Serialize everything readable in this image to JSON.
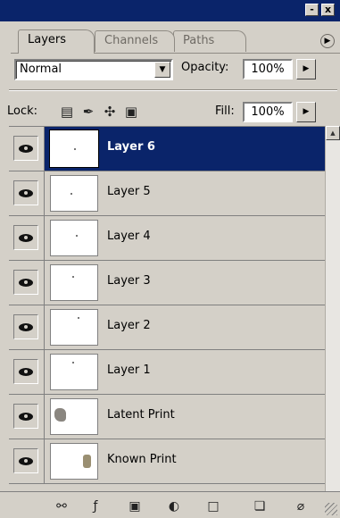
{
  "window": {
    "minimize_label": "-",
    "close_label": "x",
    "titlebar_color": "#0a246a"
  },
  "tabs": [
    {
      "label": "Layers",
      "active": true
    },
    {
      "label": "Channels",
      "active": false
    },
    {
      "label": "Paths",
      "active": false
    }
  ],
  "panel_menu_icon": "panel-menu-arrow-icon",
  "blend": {
    "mode": "Normal",
    "opacity_label": "Opacity:",
    "opacity_value": "100%"
  },
  "lock": {
    "label": "Lock:",
    "icons": [
      "lock-transparent-pixels-icon",
      "lock-image-pixels-icon",
      "lock-position-icon",
      "lock-all-icon"
    ],
    "fill_label": "Fill:",
    "fill_value": "100%"
  },
  "layers": [
    {
      "name": "Layer 6",
      "selected": true,
      "visible": true
    },
    {
      "name": "Layer 5",
      "selected": false,
      "visible": true
    },
    {
      "name": "Layer 4",
      "selected": false,
      "visible": true
    },
    {
      "name": "Layer 3",
      "selected": false,
      "visible": true
    },
    {
      "name": "Layer 2",
      "selected": false,
      "visible": true
    },
    {
      "name": "Layer 1",
      "selected": false,
      "visible": true
    },
    {
      "name": "Latent Print",
      "selected": false,
      "visible": true
    },
    {
      "name": "Known Print",
      "selected": false,
      "visible": true
    }
  ],
  "bottom_icons": [
    "link-layers-icon",
    "layer-style-icon",
    "layer-mask-icon",
    "adjustment-layer-icon",
    "new-group-icon",
    "new-layer-icon",
    "delete-layer-icon"
  ],
  "colors": {
    "selection": "#0a246a",
    "panel": "#d4d0c8"
  }
}
